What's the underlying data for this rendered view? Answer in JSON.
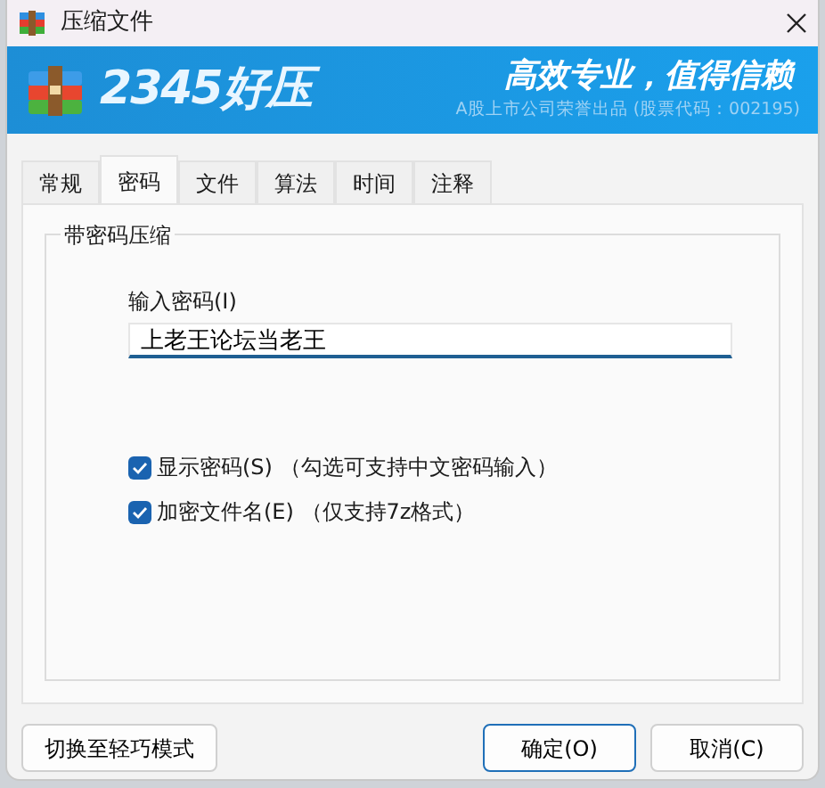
{
  "window": {
    "title": "压缩文件"
  },
  "banner": {
    "logo": "2345好压",
    "slogan": "高效专业，值得信赖",
    "subtitle": "A股上市公司荣誉出品 (股票代码：002195)"
  },
  "tabs": [
    {
      "label": "常规",
      "selected": false
    },
    {
      "label": "密码",
      "selected": true
    },
    {
      "label": "文件",
      "selected": false
    },
    {
      "label": "算法",
      "selected": false
    },
    {
      "label": "时间",
      "selected": false
    },
    {
      "label": "注释",
      "selected": false
    }
  ],
  "group": {
    "title": "带密码压缩",
    "password_label": "输入密码(I)",
    "password_value": "上老王论坛当老王",
    "options": [
      {
        "label": "显示密码(S) （勾选可支持中文密码输入）",
        "checked": true
      },
      {
        "label": "加密文件名(E) （仅支持7z格式）",
        "checked": true
      }
    ]
  },
  "left_button": {
    "label": "切换至轻巧模式"
  },
  "buttons": [
    {
      "label": "确定(O)",
      "default": true
    },
    {
      "label": "取消(C)",
      "default": false
    }
  ]
}
